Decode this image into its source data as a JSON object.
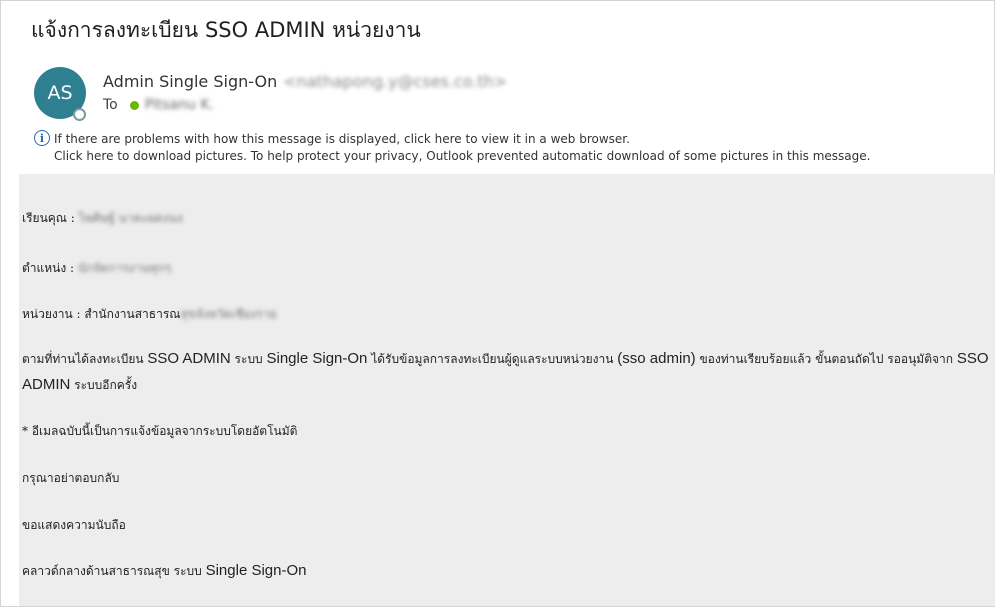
{
  "email": {
    "subject": "แจ้งการลงทะเบียน SSO ADMIN หน่วยงาน",
    "avatar_initials": "AS",
    "sender_name": "Admin Single Sign-On",
    "sender_address": "<nathapong.y@cses.co.th>",
    "to_label": "To",
    "recipient": "Pitsanu K.",
    "info_line1": "If there are problems with how this message is displayed, click here to view it in a web browser.",
    "info_line2": "Click here to download pictures. To help protect your privacy, Outlook prevented automatic download of some pictures in this message."
  },
  "body": {
    "greeting_label": "เรียนคุณ : ",
    "greeting_value": "ไพศิษฐ์ นาคะผดงนง",
    "position_label": "ตำแหน่ง : ",
    "position_value": "นักจัดการงานทุกๆ",
    "agency_label": "หน่วยงาน : สำนักงานสาธารณ",
    "agency_value": "สุขจังหวัดเชียงราย",
    "para_1a": "ตามที่ท่านได้ลงทะเบียน ",
    "para_1b": "SSO ADMIN",
    "para_1c": " ระบบ ",
    "para_1d": "Single Sign-On",
    "para_1e": " ได้รับข้อมูลการลงทะเบียนผู้ดูแลระบบหน่วยงาน ",
    "para_1f": "(sso admin)",
    "para_1g": " ของท่านเรียบร้อยแล้ว ขั้นตอนถัดไป รออนุมัติจาก ",
    "para_1h": "SSO ADMIN",
    "para_1i": " ระบบอีกครั้ง",
    "note": "* อีเมลฉบับนี้เป็นการแจ้งข้อมูลจากระบบโดยอัตโนมัติ",
    "no_reply": "กรุณาอย่าตอบกลับ",
    "thanks": "ขอแสดงความนับถือ",
    "signature_a": "คลาวด์กลางด้านสาธารณสุข ระบบ ",
    "signature_b": "Single Sign-On"
  },
  "colors": {
    "avatar_bg": "#2e7f8f",
    "body_bg": "#ededed",
    "info_icon": "#2b66b3",
    "recipient_status": "#6bb700"
  }
}
